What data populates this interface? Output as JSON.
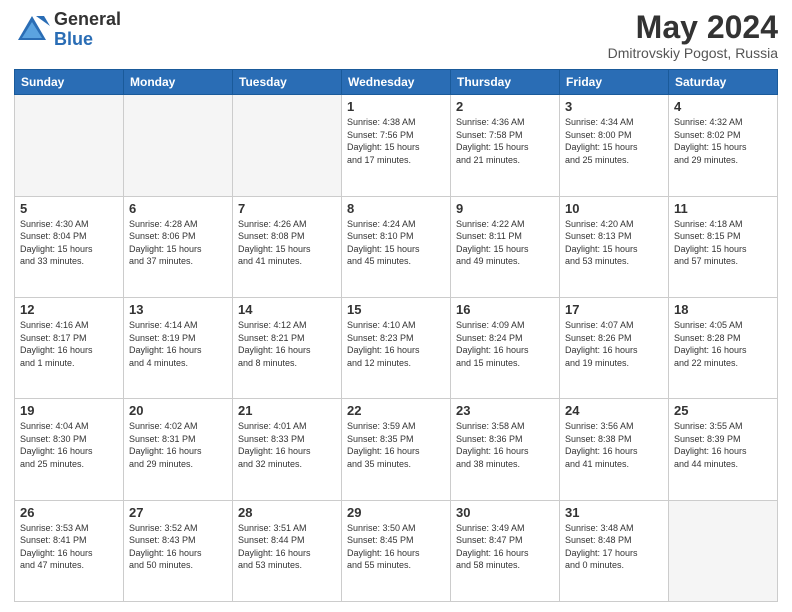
{
  "header": {
    "logo_general": "General",
    "logo_blue": "Blue",
    "month_title": "May 2024",
    "location": "Dmitrovskiy Pogost, Russia"
  },
  "days_of_week": [
    "Sunday",
    "Monday",
    "Tuesday",
    "Wednesday",
    "Thursday",
    "Friday",
    "Saturday"
  ],
  "weeks": [
    [
      {
        "day": "",
        "info": ""
      },
      {
        "day": "",
        "info": ""
      },
      {
        "day": "",
        "info": ""
      },
      {
        "day": "1",
        "info": "Sunrise: 4:38 AM\nSunset: 7:56 PM\nDaylight: 15 hours\nand 17 minutes."
      },
      {
        "day": "2",
        "info": "Sunrise: 4:36 AM\nSunset: 7:58 PM\nDaylight: 15 hours\nand 21 minutes."
      },
      {
        "day": "3",
        "info": "Sunrise: 4:34 AM\nSunset: 8:00 PM\nDaylight: 15 hours\nand 25 minutes."
      },
      {
        "day": "4",
        "info": "Sunrise: 4:32 AM\nSunset: 8:02 PM\nDaylight: 15 hours\nand 29 minutes."
      }
    ],
    [
      {
        "day": "5",
        "info": "Sunrise: 4:30 AM\nSunset: 8:04 PM\nDaylight: 15 hours\nand 33 minutes."
      },
      {
        "day": "6",
        "info": "Sunrise: 4:28 AM\nSunset: 8:06 PM\nDaylight: 15 hours\nand 37 minutes."
      },
      {
        "day": "7",
        "info": "Sunrise: 4:26 AM\nSunset: 8:08 PM\nDaylight: 15 hours\nand 41 minutes."
      },
      {
        "day": "8",
        "info": "Sunrise: 4:24 AM\nSunset: 8:10 PM\nDaylight: 15 hours\nand 45 minutes."
      },
      {
        "day": "9",
        "info": "Sunrise: 4:22 AM\nSunset: 8:11 PM\nDaylight: 15 hours\nand 49 minutes."
      },
      {
        "day": "10",
        "info": "Sunrise: 4:20 AM\nSunset: 8:13 PM\nDaylight: 15 hours\nand 53 minutes."
      },
      {
        "day": "11",
        "info": "Sunrise: 4:18 AM\nSunset: 8:15 PM\nDaylight: 15 hours\nand 57 minutes."
      }
    ],
    [
      {
        "day": "12",
        "info": "Sunrise: 4:16 AM\nSunset: 8:17 PM\nDaylight: 16 hours\nand 1 minute."
      },
      {
        "day": "13",
        "info": "Sunrise: 4:14 AM\nSunset: 8:19 PM\nDaylight: 16 hours\nand 4 minutes."
      },
      {
        "day": "14",
        "info": "Sunrise: 4:12 AM\nSunset: 8:21 PM\nDaylight: 16 hours\nand 8 minutes."
      },
      {
        "day": "15",
        "info": "Sunrise: 4:10 AM\nSunset: 8:23 PM\nDaylight: 16 hours\nand 12 minutes."
      },
      {
        "day": "16",
        "info": "Sunrise: 4:09 AM\nSunset: 8:24 PM\nDaylight: 16 hours\nand 15 minutes."
      },
      {
        "day": "17",
        "info": "Sunrise: 4:07 AM\nSunset: 8:26 PM\nDaylight: 16 hours\nand 19 minutes."
      },
      {
        "day": "18",
        "info": "Sunrise: 4:05 AM\nSunset: 8:28 PM\nDaylight: 16 hours\nand 22 minutes."
      }
    ],
    [
      {
        "day": "19",
        "info": "Sunrise: 4:04 AM\nSunset: 8:30 PM\nDaylight: 16 hours\nand 25 minutes."
      },
      {
        "day": "20",
        "info": "Sunrise: 4:02 AM\nSunset: 8:31 PM\nDaylight: 16 hours\nand 29 minutes."
      },
      {
        "day": "21",
        "info": "Sunrise: 4:01 AM\nSunset: 8:33 PM\nDaylight: 16 hours\nand 32 minutes."
      },
      {
        "day": "22",
        "info": "Sunrise: 3:59 AM\nSunset: 8:35 PM\nDaylight: 16 hours\nand 35 minutes."
      },
      {
        "day": "23",
        "info": "Sunrise: 3:58 AM\nSunset: 8:36 PM\nDaylight: 16 hours\nand 38 minutes."
      },
      {
        "day": "24",
        "info": "Sunrise: 3:56 AM\nSunset: 8:38 PM\nDaylight: 16 hours\nand 41 minutes."
      },
      {
        "day": "25",
        "info": "Sunrise: 3:55 AM\nSunset: 8:39 PM\nDaylight: 16 hours\nand 44 minutes."
      }
    ],
    [
      {
        "day": "26",
        "info": "Sunrise: 3:53 AM\nSunset: 8:41 PM\nDaylight: 16 hours\nand 47 minutes."
      },
      {
        "day": "27",
        "info": "Sunrise: 3:52 AM\nSunset: 8:43 PM\nDaylight: 16 hours\nand 50 minutes."
      },
      {
        "day": "28",
        "info": "Sunrise: 3:51 AM\nSunset: 8:44 PM\nDaylight: 16 hours\nand 53 minutes."
      },
      {
        "day": "29",
        "info": "Sunrise: 3:50 AM\nSunset: 8:45 PM\nDaylight: 16 hours\nand 55 minutes."
      },
      {
        "day": "30",
        "info": "Sunrise: 3:49 AM\nSunset: 8:47 PM\nDaylight: 16 hours\nand 58 minutes."
      },
      {
        "day": "31",
        "info": "Sunrise: 3:48 AM\nSunset: 8:48 PM\nDaylight: 17 hours\nand 0 minutes."
      },
      {
        "day": "",
        "info": ""
      }
    ]
  ]
}
